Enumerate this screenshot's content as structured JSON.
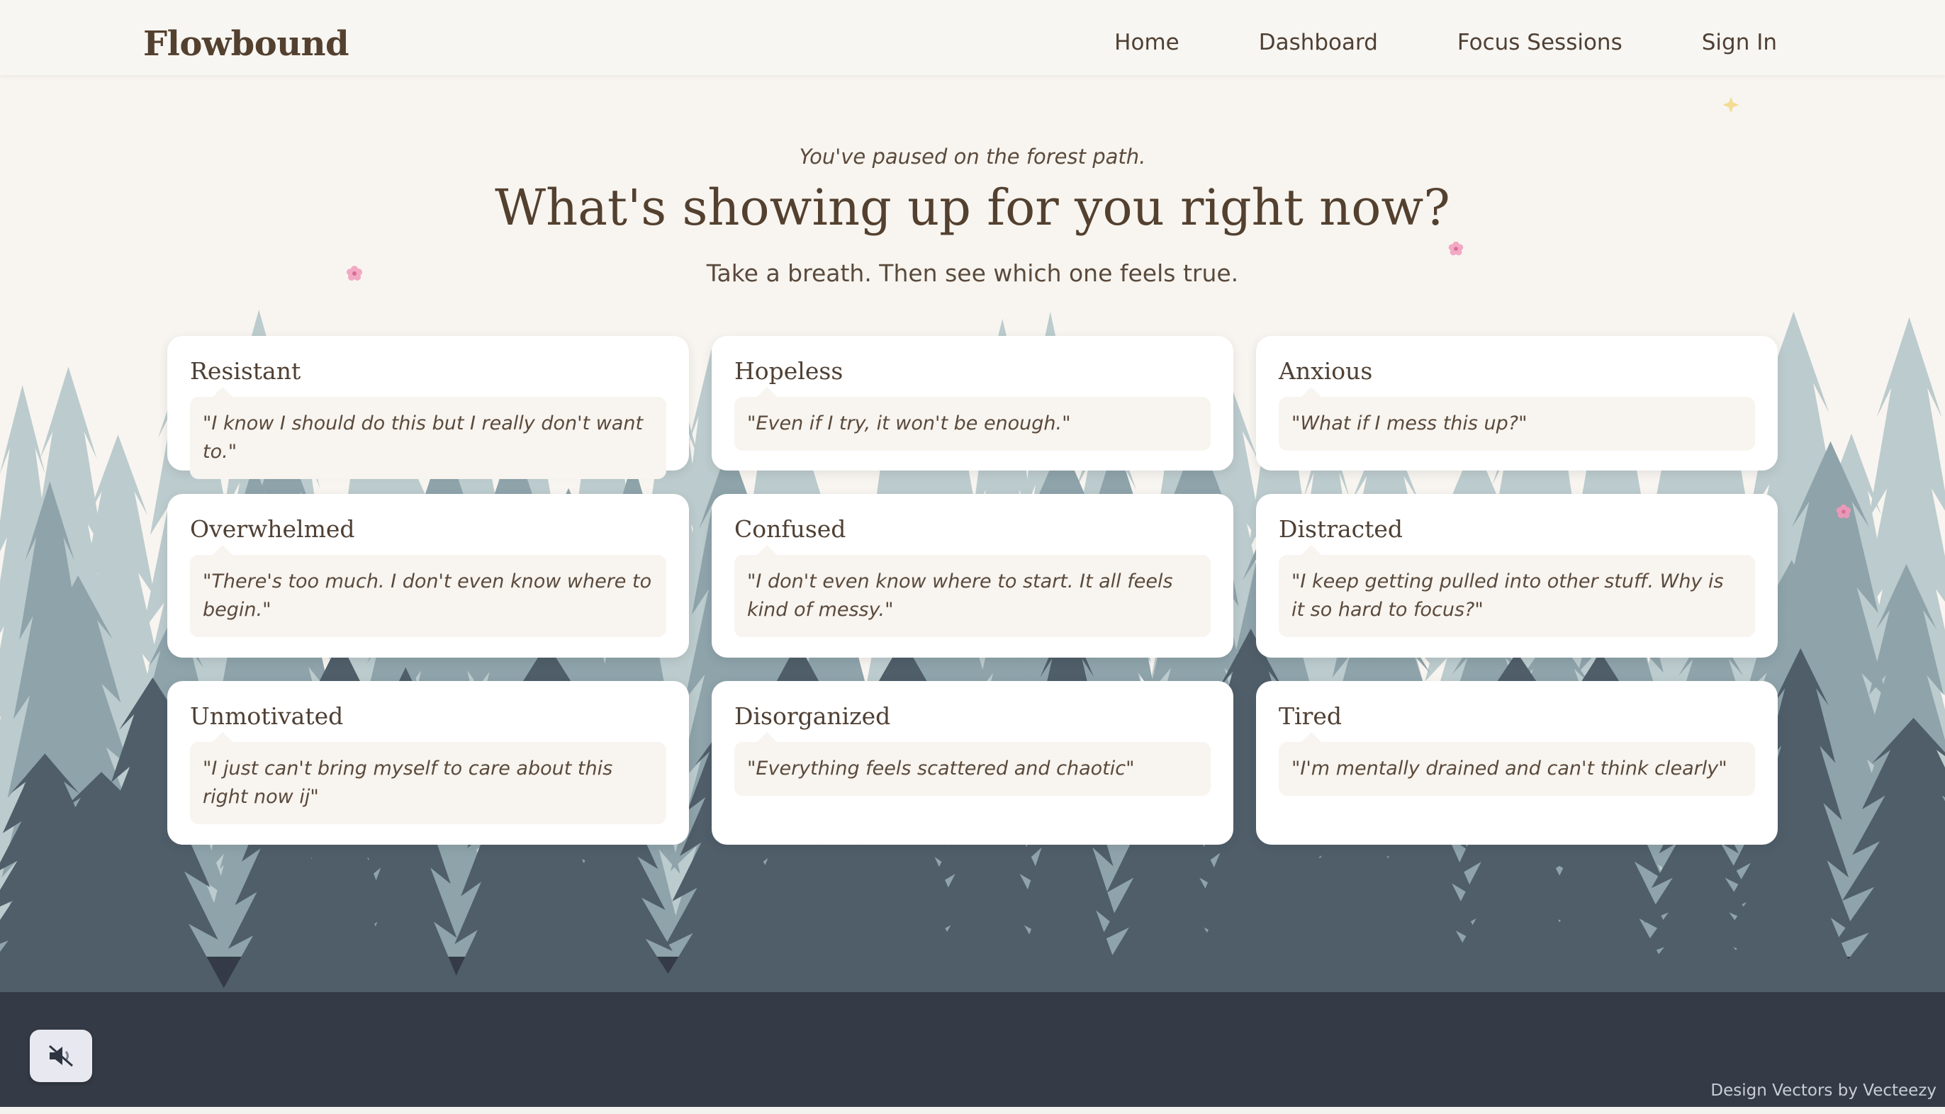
{
  "header": {
    "logo": "Flowbound",
    "nav": [
      "Home",
      "Dashboard",
      "Focus Sessions",
      "Sign In"
    ]
  },
  "intro": {
    "pretitle": "You've paused on the forest path.",
    "title": "What's showing up for you right now?",
    "subtitle": "Take a breath. Then see which one feels true."
  },
  "cards": [
    {
      "title": "Resistant",
      "quote": "\"I know I should do this but I really don't want to.\""
    },
    {
      "title": "Hopeless",
      "quote": "\"Even if I try, it won't be enough.\""
    },
    {
      "title": "Anxious",
      "quote": "\"What if I mess this up?\""
    },
    {
      "title": "Overwhelmed",
      "quote": "\"There's too much. I don't even know where to begin.\""
    },
    {
      "title": "Confused",
      "quote": "\"I don't even know where to start. It all feels kind of messy.\""
    },
    {
      "title": "Distracted",
      "quote": "\"I keep getting pulled into other stuff. Why is it so hard to focus?\""
    },
    {
      "title": "Unmotivated",
      "quote": "\"I just can't bring myself to care about this right now ij\""
    },
    {
      "title": "Disorganized",
      "quote": "\"Everything feels scattered and chaotic\""
    },
    {
      "title": "Tired",
      "quote": "\"I'm mentally drained and can't think clearly\""
    }
  ],
  "footer": {
    "credit": "Design Vectors by Vecteezy",
    "sound_icon": "speaker-muted-icon"
  },
  "colors": {
    "background": "#f8f5f0",
    "text": "#4f4034",
    "forest_light": "#b6c6c8",
    "forest_mid": "#7b929a",
    "forest_dark": "#343b46"
  }
}
